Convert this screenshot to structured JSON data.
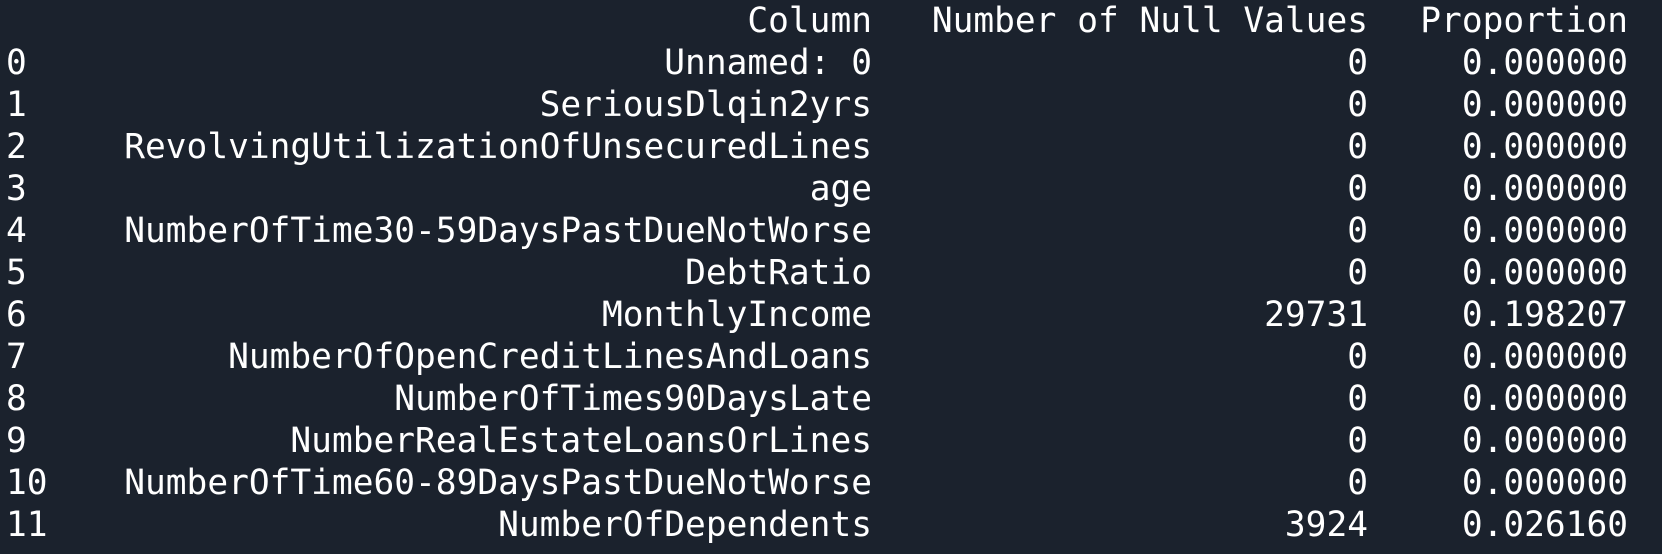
{
  "output": {
    "headers": {
      "column": "Column",
      "nulls": "Number of Null Values",
      "proportion": "Proportion"
    },
    "rows": [
      {
        "index": "0",
        "column": "Unnamed: 0",
        "nulls": "0",
        "proportion": "0.000000"
      },
      {
        "index": "1",
        "column": "SeriousDlqin2yrs",
        "nulls": "0",
        "proportion": "0.000000"
      },
      {
        "index": "2",
        "column": "RevolvingUtilizationOfUnsecuredLines",
        "nulls": "0",
        "proportion": "0.000000"
      },
      {
        "index": "3",
        "column": "age",
        "nulls": "0",
        "proportion": "0.000000"
      },
      {
        "index": "4",
        "column": "NumberOfTime30-59DaysPastDueNotWorse",
        "nulls": "0",
        "proportion": "0.000000"
      },
      {
        "index": "5",
        "column": "DebtRatio",
        "nulls": "0",
        "proportion": "0.000000"
      },
      {
        "index": "6",
        "column": "MonthlyIncome",
        "nulls": "29731",
        "proportion": "0.198207"
      },
      {
        "index": "7",
        "column": "NumberOfOpenCreditLinesAndLoans",
        "nulls": "0",
        "proportion": "0.000000"
      },
      {
        "index": "8",
        "column": "NumberOfTimes90DaysLate",
        "nulls": "0",
        "proportion": "0.000000"
      },
      {
        "index": "9",
        "column": "NumberRealEstateLoansOrLines",
        "nulls": "0",
        "proportion": "0.000000"
      },
      {
        "index": "10",
        "column": "NumberOfTime60-89DaysPastDueNotWorse",
        "nulls": "0",
        "proportion": "0.000000"
      },
      {
        "index": "11",
        "column": "NumberOfDependents",
        "nulls": "3924",
        "proportion": "0.026160"
      }
    ]
  },
  "colors": {
    "background": "#1b222d",
    "text": "#ffffff"
  }
}
